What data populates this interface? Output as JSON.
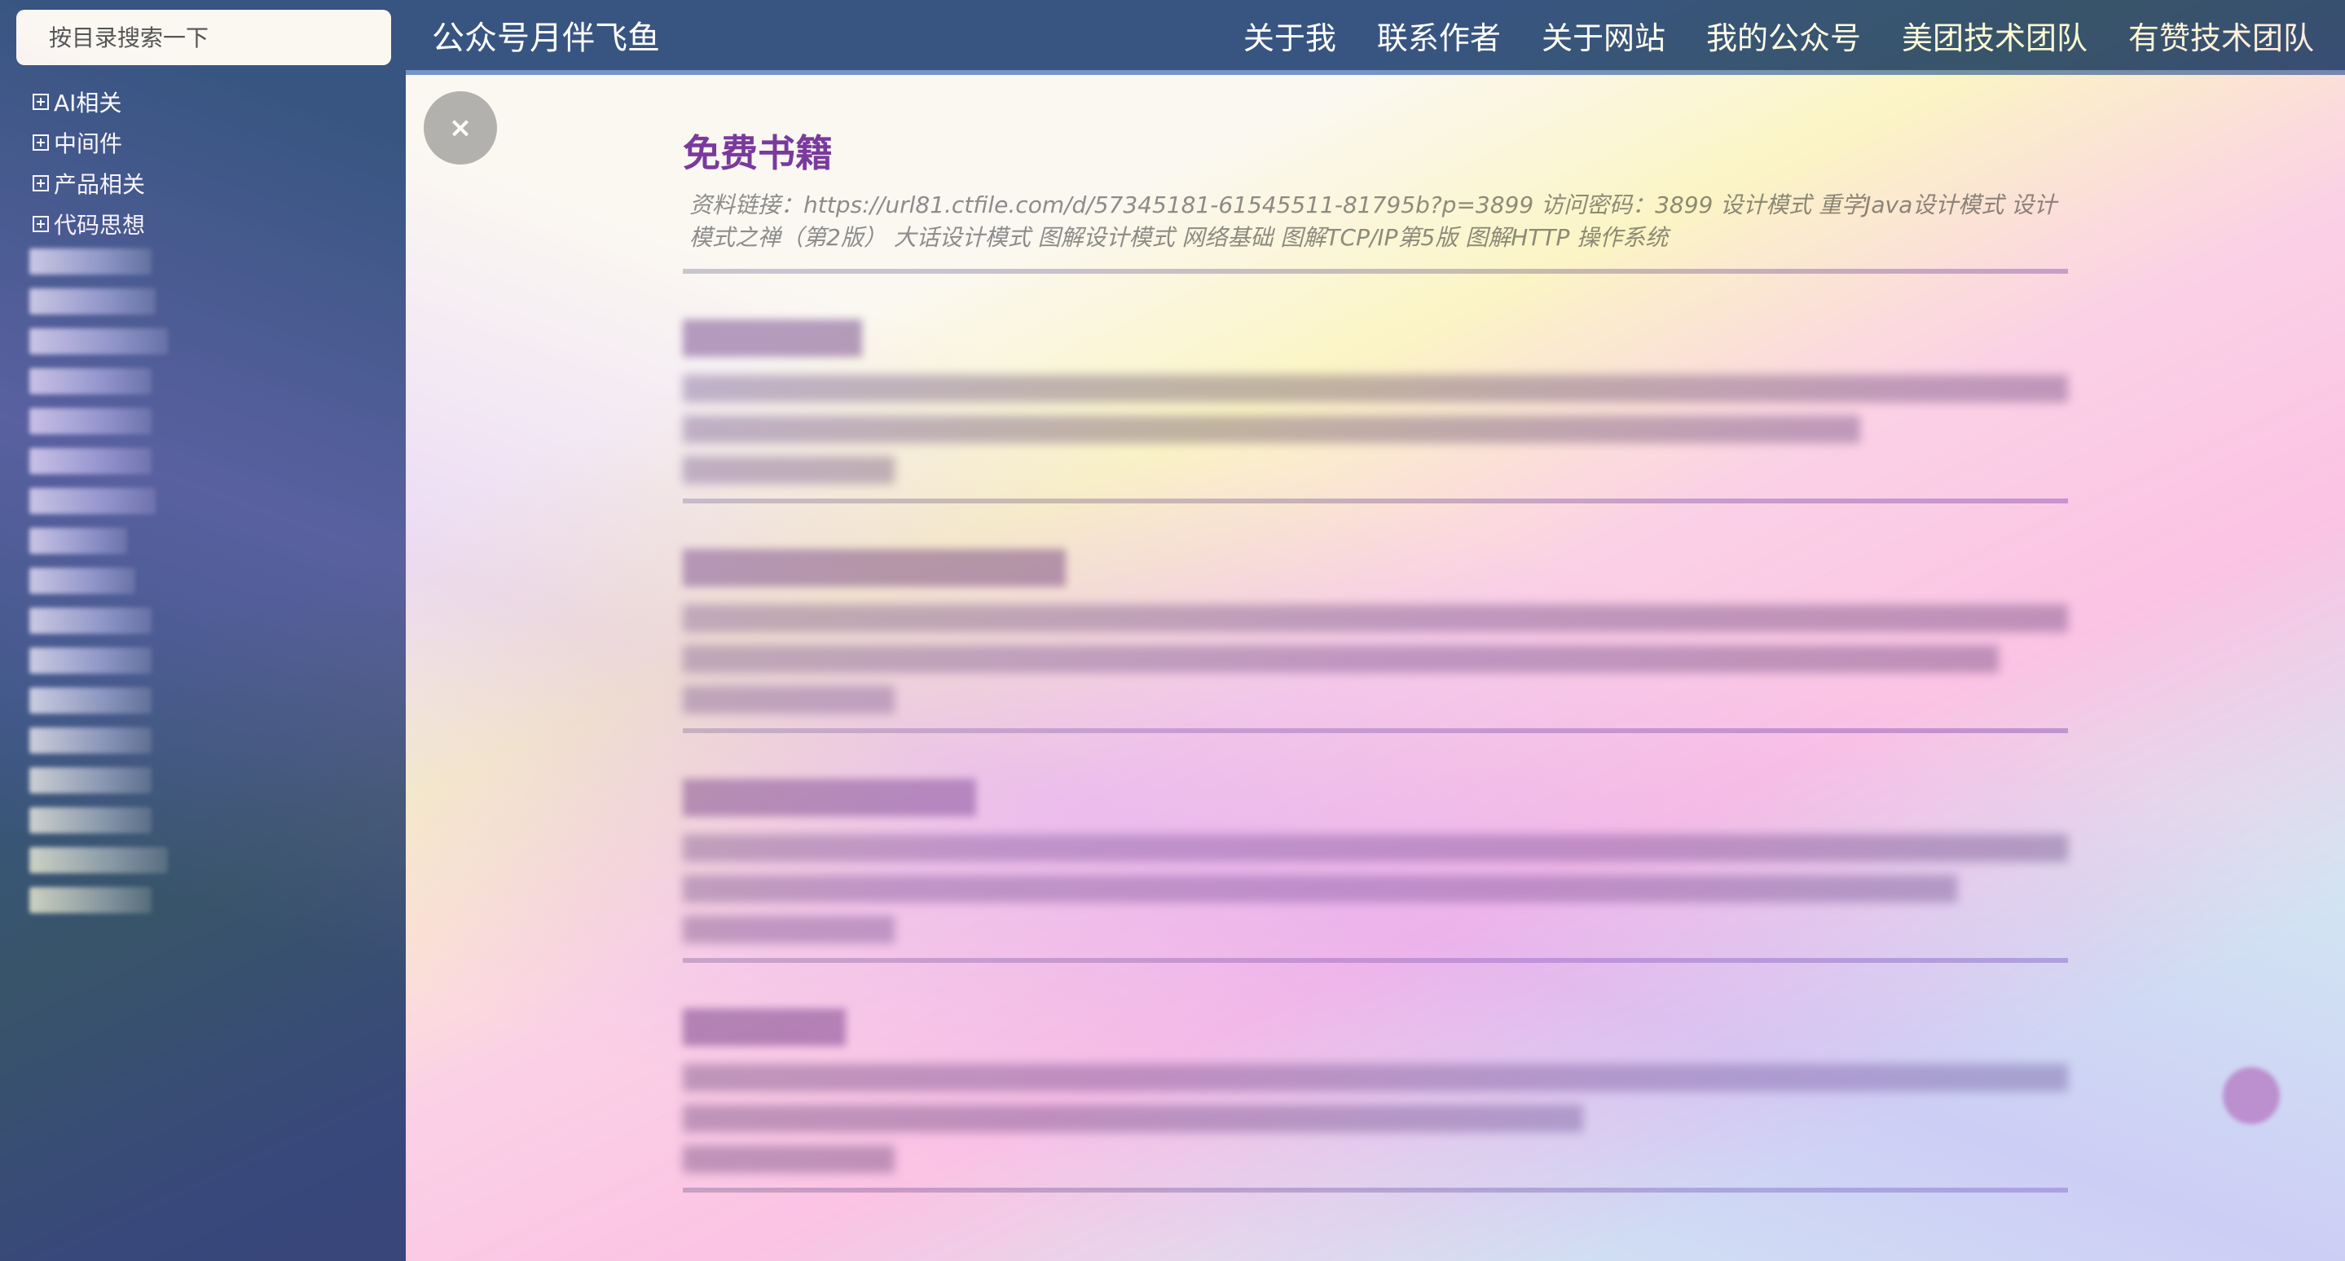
{
  "sidebar": {
    "search_placeholder": "按目录搜索一下",
    "items": [
      {
        "label": "AI相关"
      },
      {
        "label": "中间件"
      },
      {
        "label": "产品相关"
      },
      {
        "label": "代码思想"
      }
    ]
  },
  "navbar": {
    "brand": "公众号月伴飞鱼",
    "links": [
      {
        "label": "关于我"
      },
      {
        "label": "联系作者"
      },
      {
        "label": "关于网站"
      },
      {
        "label": "我的公众号"
      },
      {
        "label": "美团技术团队"
      },
      {
        "label": "有赞技术团队"
      }
    ]
  },
  "main": {
    "close_label": "×",
    "article": {
      "title": "免费书籍",
      "description": "资料链接：https://url81.ctfile.com/d/57345181-61545511-81795b?p=3899 访问密码：3899 设计模式 重学Java设计模式 设计模式之禅（第2版） 大话设计模式 图解设计模式 网络基础 图解TCP/IP第5版 图解HTTP 操作系统"
    }
  }
}
